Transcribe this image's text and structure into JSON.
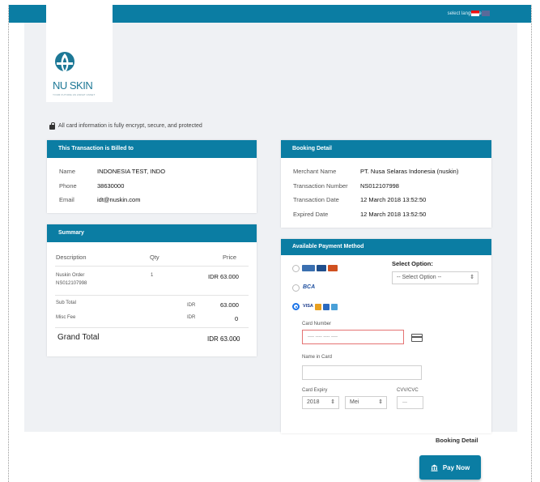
{
  "topbar": {
    "language_label": "select language :"
  },
  "brand": {
    "logo_text": "NU SKIN",
    "tagline": "YOUR FUTURE AS ASKET ASSET"
  },
  "secure_note": "All card information is fully encrypt, secure, and protected",
  "billed": {
    "title": "This Transaction is Billed to",
    "name_label": "Name",
    "name": "INDONESIA TEST, INDO",
    "phone_label": "Phone",
    "phone": "38630000",
    "email_label": "Email",
    "email": "idt@nuskin.com"
  },
  "summary": {
    "title": "Summary",
    "col_description": "Description",
    "col_qty": "Qty",
    "col_price": "Price",
    "item_name": "Nuskin Order",
    "item_code": "NS012107998",
    "item_qty": "1",
    "item_price": "IDR 63.000",
    "subtotal_label": "Sub Total",
    "subtotal_cur": "IDR",
    "subtotal_value": "63.000",
    "fee_label": "Misc Fee",
    "fee_cur": "IDR",
    "fee_value": "0",
    "grand_label": "Grand Total",
    "grand_value": "IDR 63.000"
  },
  "booking": {
    "title": "Booking Detail",
    "merchant_label": "Merchant Name",
    "merchant": "PT. Nusa Selaras Indonesia (nuskin)",
    "txn_label": "Transaction Number",
    "txn": "NS012107998",
    "txn_date_label": "Transaction Date",
    "txn_date": "12 March 2018 13:52:50",
    "exp_label": "Expired Date",
    "exp": "12 March 2018 13:52:50"
  },
  "payment": {
    "title": "Available Payment Method",
    "select_option_label": "Select Option:",
    "select_option_value": "-- Select Option --",
    "bca_text": "BCA",
    "visa_text": "VISA",
    "card_number_label": "Card Number",
    "card_number_placeholder": "---- ---- ---- ----",
    "name_label": "Name in Card",
    "expiry_label": "Card Expiry",
    "expiry_year": "2018",
    "expiry_month": "Mei",
    "cvv_label": "CVV/CVC",
    "cvv_placeholder": "---"
  },
  "footer": {
    "booking_detail_link": "Booking Detail",
    "pay_button": "Pay Now"
  },
  "colors": {
    "accent": "#0b7da3"
  }
}
